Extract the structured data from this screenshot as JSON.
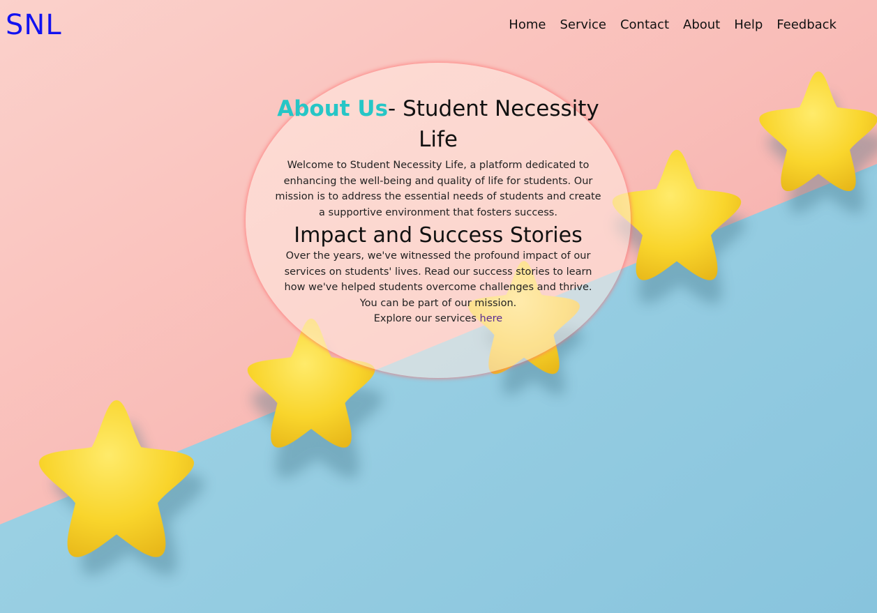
{
  "brand": {
    "logo": "SNL"
  },
  "nav": {
    "items": [
      {
        "label": "Home"
      },
      {
        "label": "Service"
      },
      {
        "label": "Contact"
      },
      {
        "label": "About"
      },
      {
        "label": "Help"
      },
      {
        "label": "Feedback"
      }
    ]
  },
  "about": {
    "title_accent": "About Us",
    "title_rest": "- Student Necessity Life",
    "intro": "Welcome to Student Necessity Life, a platform dedicated to enhancing the well-being and quality of life for students. Our mission is to address the essential needs of students and create a supportive environment that fosters success.",
    "impact_heading": "Impact and Success Stories",
    "impact_text": "Over the years, we've witnessed the profound impact of our services on students' lives. Read our success stories to learn how we've helped students overcome challenges and thrive.",
    "mission_line": "You can be part of our mission.",
    "explore_prefix": "Explore our services ",
    "explore_link": "here"
  },
  "colors": {
    "logo": "#1212f0",
    "accent": "#26c6c6",
    "link": "#5a2d91",
    "background_pink": "#f7b1ae",
    "background_blue": "#9fd2e4",
    "star_yellow": "#f8d631"
  }
}
